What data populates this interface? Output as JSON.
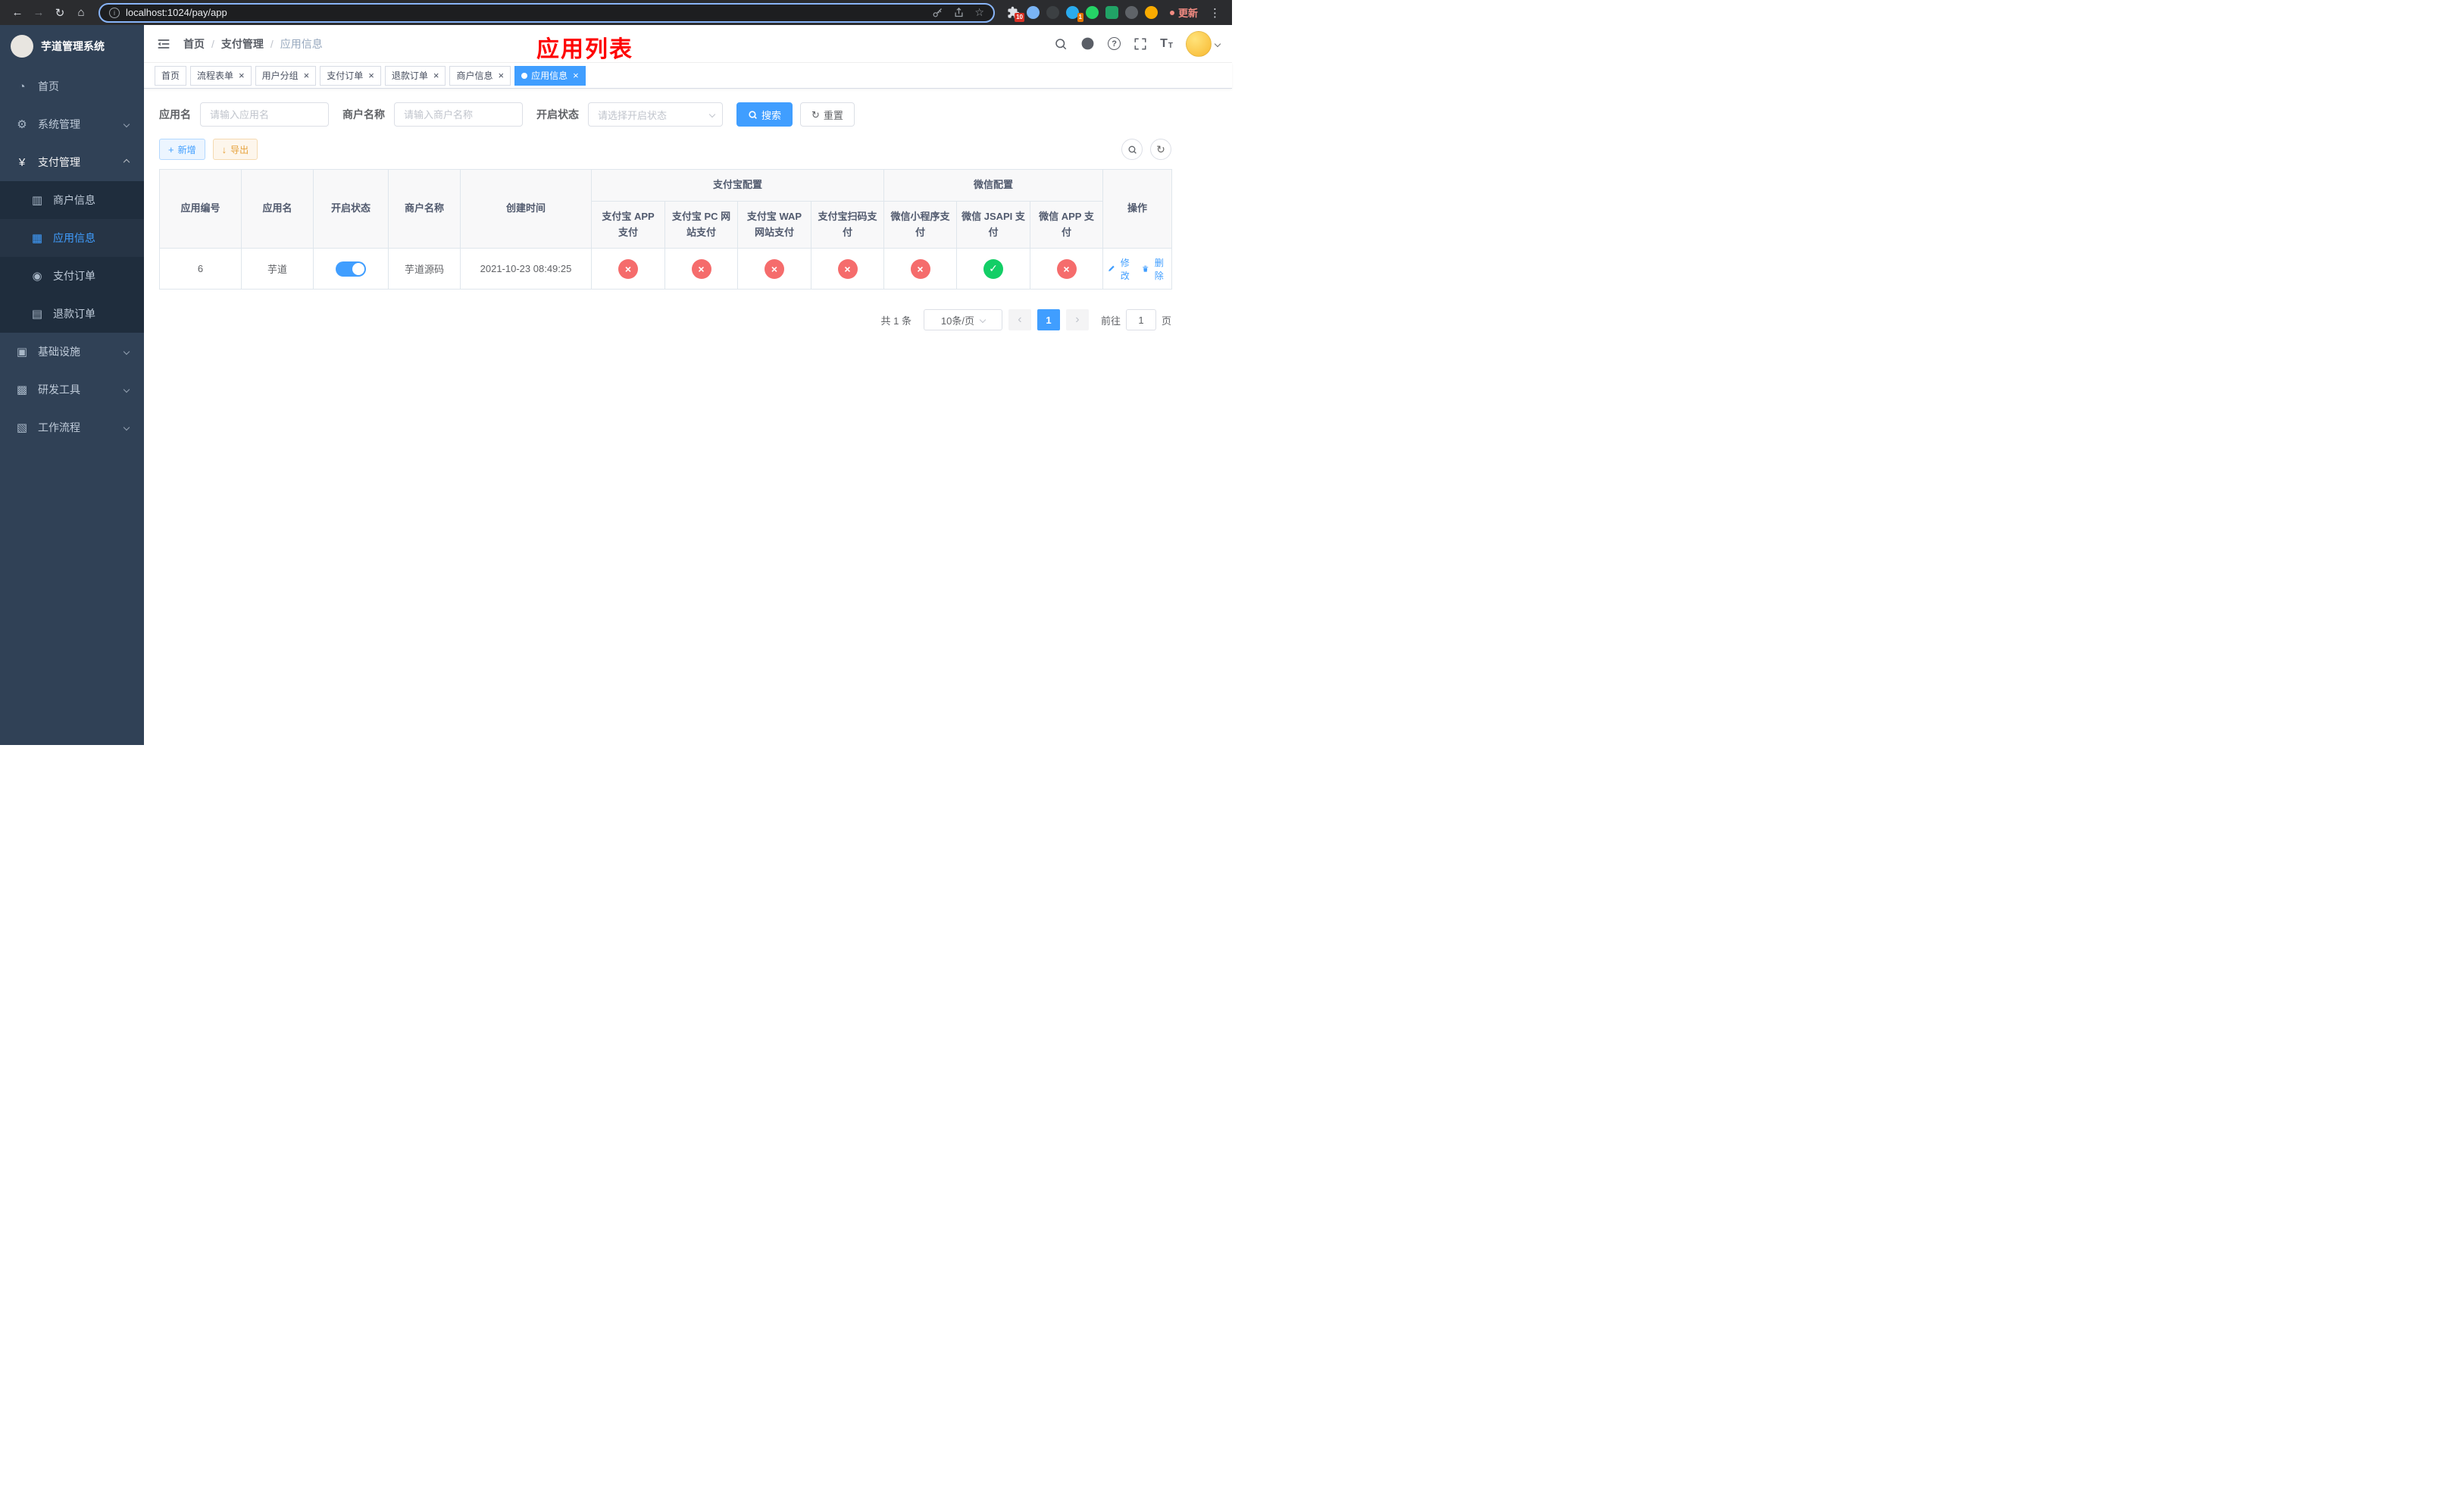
{
  "colors": {
    "accent": "#409eff",
    "success": "#13ce66",
    "danger": "#f56c6c",
    "warning": "#e6a23c",
    "title_red": "#ff0000",
    "sidebar_bg": "#304156",
    "submenu_bg": "#1f2d3d"
  },
  "browser": {
    "url": "localhost:1024/pay/app",
    "update": "更新",
    "ext_badge_a": "10",
    "ext_badge_b": "1"
  },
  "icons": {
    "back": "←",
    "forward": "→",
    "reload": "↻",
    "home": "⌂",
    "info": "i",
    "star": "☆",
    "dots": "⋮",
    "dashboard": "◔",
    "gear": "⚙",
    "yen": "¥",
    "merchant": "▥",
    "app": "▦",
    "order": "◉",
    "refund": "▤",
    "infra": "▣",
    "tools": "▩",
    "flow": "▧",
    "question": "?",
    "plus": "+",
    "download": "↓",
    "refresh": "↻",
    "cross": "×",
    "check": "✓",
    "prev": "‹",
    "next": "›",
    "letter_big": "T",
    "letter_small": "T"
  },
  "sidebar": {
    "title": "芋道管理系统",
    "home": "首页",
    "system": "系统管理",
    "payment": "支付管理",
    "merchant_info": "商户信息",
    "app_info": "应用信息",
    "pay_order": "支付订单",
    "refund_order": "退款订单",
    "infrastructure": "基础设施",
    "dev_tools": "研发工具",
    "workflow": "工作流程"
  },
  "breadcrumb": {
    "home": "首页",
    "sep": "/",
    "section": "支付管理",
    "current": "应用信息"
  },
  "overlay_title": "应用列表",
  "tabs": [
    {
      "label": "首页"
    },
    {
      "label": "流程表单"
    },
    {
      "label": "用户分组"
    },
    {
      "label": "支付订单"
    },
    {
      "label": "退款订单"
    },
    {
      "label": "商户信息"
    },
    {
      "label": "应用信息"
    }
  ],
  "filters": {
    "app_name_label": "应用名",
    "app_name_placeholder": "请输入应用名",
    "merchant_label": "商户名称",
    "merchant_placeholder": "请输入商户名称",
    "status_label": "开启状态",
    "status_placeholder": "请选择开启状态",
    "search": "搜索",
    "reset": "重置"
  },
  "toolbar": {
    "add": "新增",
    "export": "导出"
  },
  "table": {
    "col_id": "应用编号",
    "col_name": "应用名",
    "col_status": "开启状态",
    "col_merchant": "商户名称",
    "col_created": "创建时间",
    "col_actions": "操作",
    "group_alipay": "支付宝配置",
    "group_wechat": "微信配置",
    "col_alipay_app": "支付宝 APP 支付",
    "col_alipay_pc": "支付宝 PC 网站支付",
    "col_alipay_wap": "支付宝 WAP 网站支付",
    "col_alipay_qr": "支付宝扫码支付",
    "col_wx_lite": "微信小程序支付",
    "col_wx_jsapi": "微信 JSAPI 支付",
    "col_wx_app": "微信 APP 支付",
    "row": {
      "id": "6",
      "name": "芋道",
      "status": "on",
      "merchant": "芋道源码",
      "created": "2021-10-23 08:49:25",
      "alipay_app": "disabled",
      "alipay_pc": "disabled",
      "alipay_wap": "disabled",
      "alipay_qr": "disabled",
      "wx_lite": "disabled",
      "wx_jsapi": "enabled",
      "wx_app": "disabled",
      "edit": "修改",
      "delete": "删除"
    }
  },
  "pagination": {
    "total": "共 1 条",
    "page_size": "10条/页",
    "page": "1",
    "goto": "前往",
    "unit": "页",
    "goto_value": "1"
  }
}
